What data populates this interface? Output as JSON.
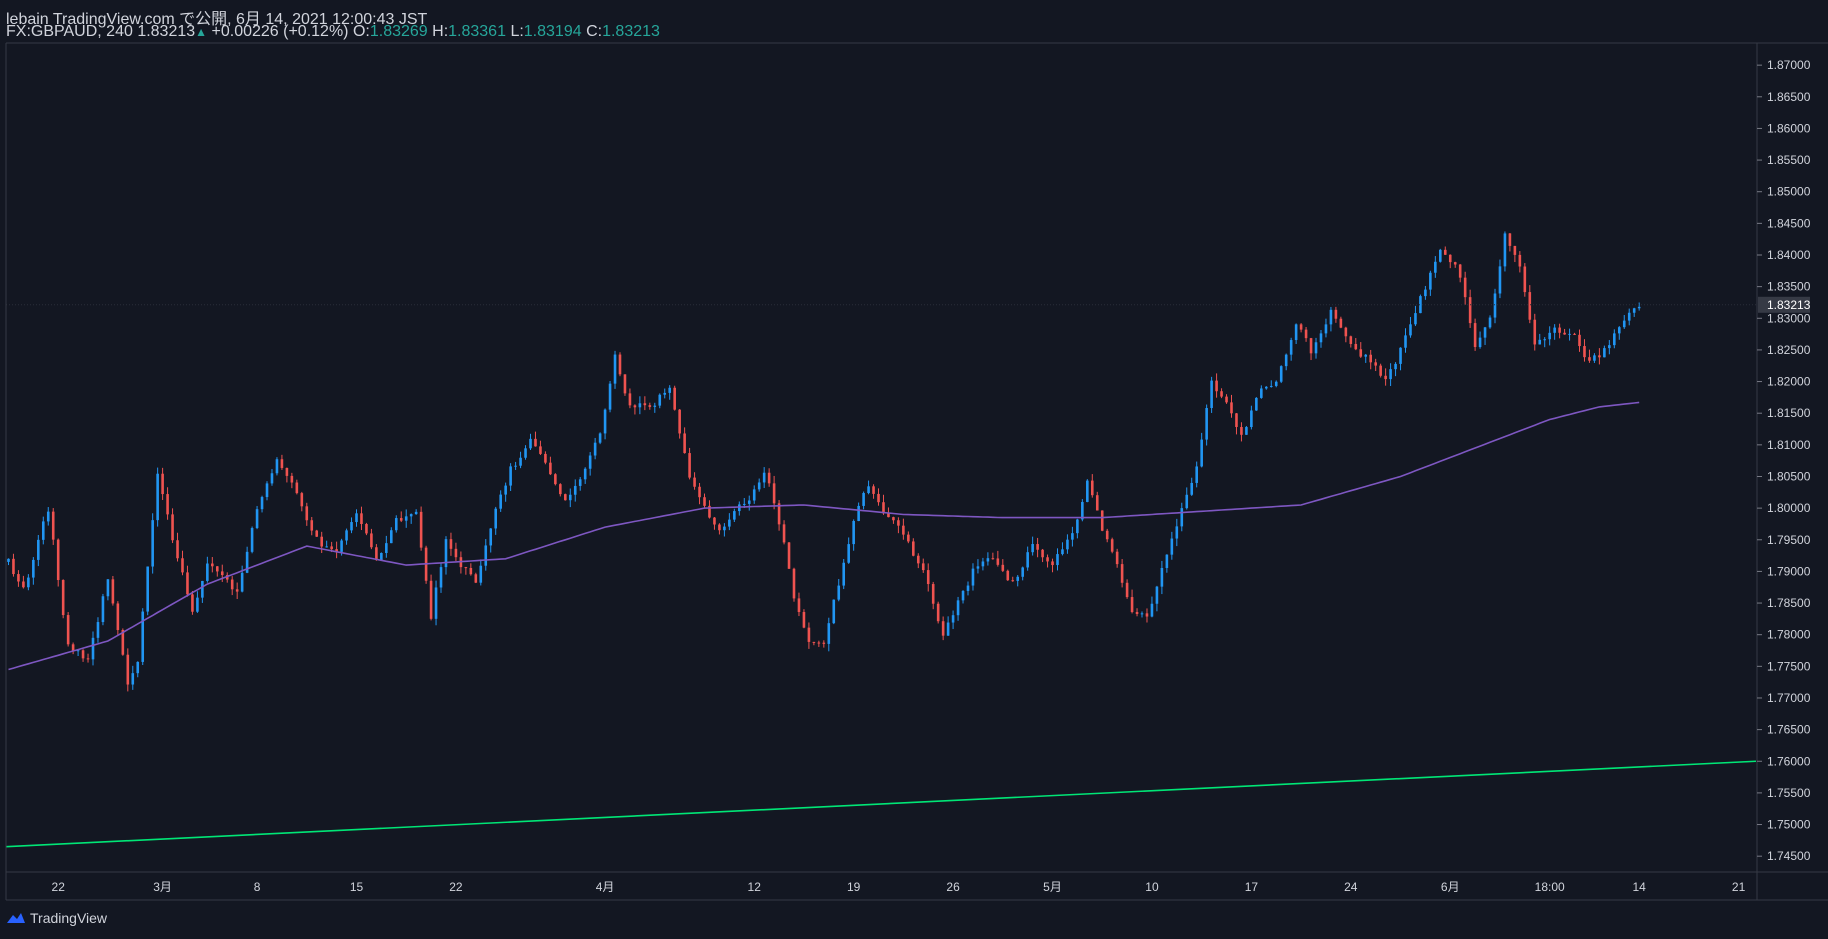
{
  "header": {
    "published": "lebain TradingView.com で公開, 6月 14, 2021 12:00:43 JST",
    "symbol": "FX:GBPAUD, 240",
    "last": "1.83213",
    "change": "+0.00226 (+0.12%)",
    "o_label": "O:",
    "o": "1.83269",
    "h_label": "H:",
    "h": "1.83361",
    "l_label": "L:",
    "l": "1.83194",
    "c_label": "C:",
    "c": "1.83213"
  },
  "footer": {
    "brand": "TradingView"
  },
  "colors": {
    "background": "#131722",
    "up": "#2196f3",
    "down": "#ef5350",
    "ma": "#7e57c2",
    "trend": "#00e676",
    "text": "#d1d4dc",
    "ohlc_value": "#26a69a"
  },
  "chart_data": {
    "type": "candlestick",
    "timeframe": "240",
    "ylim": [
      1.7425,
      1.8735
    ],
    "price_ticks": [
      "1.87000",
      "1.86500",
      "1.86000",
      "1.85500",
      "1.85000",
      "1.84500",
      "1.84000",
      "1.83500",
      "1.83000",
      "1.82500",
      "1.82000",
      "1.81500",
      "1.81000",
      "1.80500",
      "1.80000",
      "1.79500",
      "1.79000",
      "1.78500",
      "1.78000",
      "1.77500",
      "1.77000",
      "1.76500",
      "1.76000",
      "1.75500",
      "1.75000",
      "1.74500"
    ],
    "last_price_label": "1.83213",
    "time_ticks": [
      {
        "label": "22",
        "i": 10
      },
      {
        "label": "3月",
        "i": 31
      },
      {
        "label": "8",
        "i": 50
      },
      {
        "label": "15",
        "i": 70
      },
      {
        "label": "22",
        "i": 90
      },
      {
        "label": "4月",
        "i": 120
      },
      {
        "label": "12",
        "i": 150
      },
      {
        "label": "19",
        "i": 170
      },
      {
        "label": "26",
        "i": 190
      },
      {
        "label": "5月",
        "i": 210
      },
      {
        "label": "10",
        "i": 230
      },
      {
        "label": "17",
        "i": 250
      },
      {
        "label": "24",
        "i": 270
      },
      {
        "label": "6月",
        "i": 290
      },
      {
        "label": "18:00",
        "i": 310
      },
      {
        "label": "14",
        "i": 328
      },
      {
        "label": "21",
        "i": 348
      }
    ],
    "path_anchors": [
      [
        0,
        1.7915
      ],
      [
        3,
        1.787
      ],
      [
        8,
        1.8
      ],
      [
        12,
        1.778
      ],
      [
        16,
        1.776
      ],
      [
        20,
        1.789
      ],
      [
        24,
        1.772
      ],
      [
        26,
        1.776
      ],
      [
        30,
        1.806
      ],
      [
        33,
        1.795
      ],
      [
        37,
        1.784
      ],
      [
        40,
        1.791
      ],
      [
        46,
        1.787
      ],
      [
        50,
        1.8
      ],
      [
        54,
        1.808
      ],
      [
        58,
        1.802
      ],
      [
        62,
        1.795
      ],
      [
        66,
        1.793
      ],
      [
        70,
        1.799
      ],
      [
        74,
        1.792
      ],
      [
        78,
        1.798
      ],
      [
        82,
        1.8
      ],
      [
        85,
        1.783
      ],
      [
        88,
        1.795
      ],
      [
        91,
        1.791
      ],
      [
        94,
        1.788
      ],
      [
        98,
        1.8
      ],
      [
        101,
        1.806
      ],
      [
        105,
        1.811
      ],
      [
        108,
        1.807
      ],
      [
        112,
        1.801
      ],
      [
        116,
        1.806
      ],
      [
        119,
        1.812
      ],
      [
        122,
        1.824
      ],
      [
        125,
        1.816
      ],
      [
        129,
        1.816
      ],
      [
        133,
        1.819
      ],
      [
        137,
        1.805
      ],
      [
        140,
        1.8
      ],
      [
        143,
        1.796
      ],
      [
        146,
        1.8
      ],
      [
        149,
        1.801
      ],
      [
        152,
        1.806
      ],
      [
        155,
        1.798
      ],
      [
        158,
        1.786
      ],
      [
        161,
        1.779
      ],
      [
        164,
        1.779
      ],
      [
        167,
        1.788
      ],
      [
        170,
        1.798
      ],
      [
        173,
        1.804
      ],
      [
        176,
        1.799
      ],
      [
        179,
        1.797
      ],
      [
        182,
        1.793
      ],
      [
        185,
        1.788
      ],
      [
        188,
        1.78
      ],
      [
        191,
        1.785
      ],
      [
        194,
        1.79
      ],
      [
        198,
        1.792
      ],
      [
        202,
        1.788
      ],
      [
        206,
        1.794
      ],
      [
        210,
        1.791
      ],
      [
        214,
        1.796
      ],
      [
        217,
        1.804
      ],
      [
        220,
        1.797
      ],
      [
        223,
        1.791
      ],
      [
        226,
        1.784
      ],
      [
        229,
        1.783
      ],
      [
        232,
        1.79
      ],
      [
        236,
        1.8
      ],
      [
        239,
        1.806
      ],
      [
        242,
        1.82
      ],
      [
        245,
        1.817
      ],
      [
        248,
        1.811
      ],
      [
        251,
        1.818
      ],
      [
        255,
        1.82
      ],
      [
        259,
        1.829
      ],
      [
        262,
        1.825
      ],
      [
        266,
        1.831
      ],
      [
        270,
        1.826
      ],
      [
        274,
        1.823
      ],
      [
        277,
        1.82
      ],
      [
        280,
        1.825
      ],
      [
        284,
        1.833
      ],
      [
        288,
        1.841
      ],
      [
        292,
        1.837
      ],
      [
        295,
        1.826
      ],
      [
        298,
        1.83
      ],
      [
        301,
        1.843
      ],
      [
        304,
        1.838
      ],
      [
        307,
        1.826
      ],
      [
        311,
        1.828
      ],
      [
        315,
        1.827
      ],
      [
        318,
        1.823
      ],
      [
        321,
        1.825
      ],
      [
        324,
        1.829
      ],
      [
        328,
        1.8321
      ]
    ],
    "ma_anchors": [
      [
        0,
        1.7745
      ],
      [
        20,
        1.779
      ],
      [
        40,
        1.788
      ],
      [
        60,
        1.794
      ],
      [
        80,
        1.791
      ],
      [
        100,
        1.792
      ],
      [
        120,
        1.797
      ],
      [
        140,
        1.8
      ],
      [
        160,
        1.8005
      ],
      [
        180,
        1.799
      ],
      [
        200,
        1.7985
      ],
      [
        220,
        1.7985
      ],
      [
        240,
        1.7995
      ],
      [
        260,
        1.8005
      ],
      [
        280,
        1.805
      ],
      [
        300,
        1.811
      ],
      [
        310,
        1.814
      ],
      [
        320,
        1.816
      ],
      [
        328,
        1.8167
      ]
    ],
    "trendline": {
      "from": [
        0,
        1.7465
      ],
      "to": [
        352,
        1.76
      ],
      "extends_right": true,
      "color": "#00e676"
    }
  }
}
